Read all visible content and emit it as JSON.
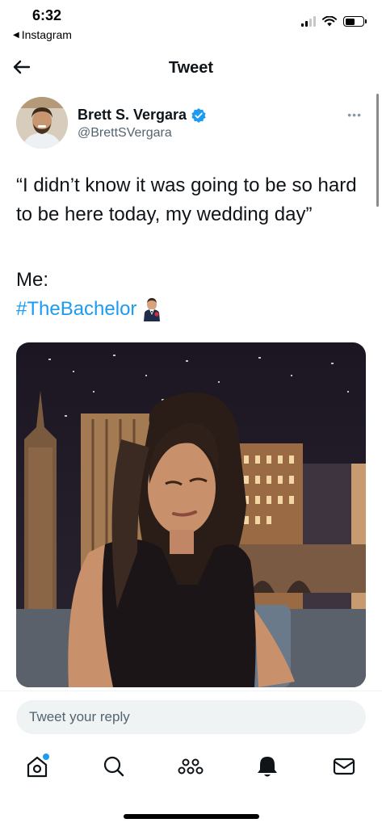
{
  "status_bar": {
    "time": "6:32",
    "back_app": "Instagram",
    "signal_bars_active": 2,
    "battery_level": 0.55
  },
  "header": {
    "title": "Tweet",
    "back_icon": "arrow-left-icon"
  },
  "tweet": {
    "author": {
      "name": "Brett S. Vergara",
      "handle": "@BrettSVergara",
      "verified": true
    },
    "text": "“I didn’t know it was going to be so hard to be here today, my wedding day”",
    "line_me": "Me:",
    "hashtag": "#TheBachelor",
    "hashtag_emoji_icon": "bachelor-emoji-icon",
    "media_description_icon": "embedded-photo"
  },
  "reply": {
    "placeholder": "Tweet your reply"
  },
  "tabbar": {
    "items": [
      {
        "name": "home",
        "icon": "home-icon",
        "has_notification_dot": true
      },
      {
        "name": "search",
        "icon": "search-icon"
      },
      {
        "name": "spaces",
        "icon": "spaces-icon"
      },
      {
        "name": "notifications",
        "icon": "bell-icon"
      },
      {
        "name": "messages",
        "icon": "envelope-icon"
      }
    ]
  },
  "colors": {
    "accent": "#1d9bf0",
    "text_primary": "#0f1419",
    "text_secondary": "#536471",
    "reply_bg": "#eff3f4"
  }
}
